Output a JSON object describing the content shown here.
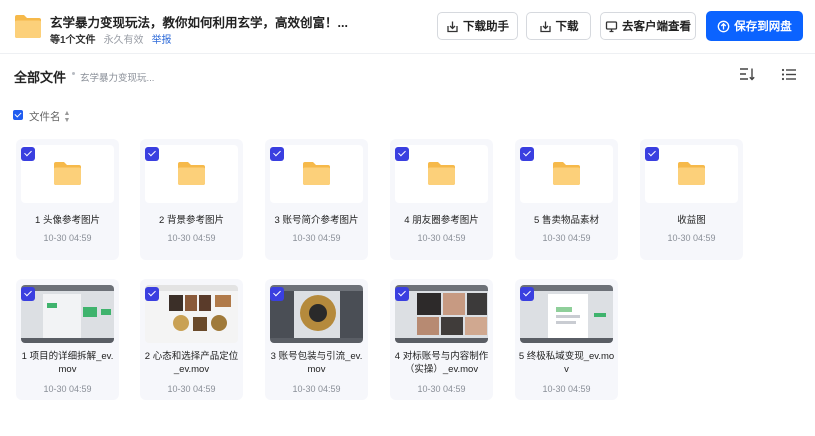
{
  "header": {
    "title": "玄学暴力变现玩法，教你如何利用玄学，高效创富！...",
    "file_count": "等1个文件",
    "validity": "永久有效",
    "report": "举报"
  },
  "actions": {
    "helper": "下载助手",
    "download": "下载",
    "client": "去客户端查看",
    "save": "保存到网盘"
  },
  "breadcrumb": {
    "root": "全部文件",
    "current": "玄学暴力变现玩..."
  },
  "list_header": {
    "column_name": "文件名"
  },
  "colors": {
    "accent": "#0b63ff",
    "checkbox": "#3a3fe0",
    "folder": "#fbc86b"
  },
  "folders": [
    {
      "name": "1 头像参考图片",
      "date": "10-30 04:59",
      "icon": "folder-icon"
    },
    {
      "name": "2 背景参考图片",
      "date": "10-30 04:59",
      "icon": "folder-icon"
    },
    {
      "name": "3 账号简介参考图片",
      "date": "10-30 04:59",
      "icon": "folder-icon"
    },
    {
      "name": "4 朋友圈参考图片",
      "date": "10-30 04:59",
      "icon": "folder-icon"
    },
    {
      "name": "5 售卖物品素材",
      "date": "10-30 04:59",
      "icon": "folder-icon"
    },
    {
      "name": "收益图",
      "date": "10-30 04:59",
      "icon": "folder-icon"
    }
  ],
  "videos": [
    {
      "name": "1 项目的详细拆解_ev.mov",
      "date": "10-30 04:59"
    },
    {
      "name": "2 心态和选择产品定位_ev.mov",
      "date": "10-30 04:59"
    },
    {
      "name": "3 账号包装与引流_ev.mov",
      "date": "10-30 04:59"
    },
    {
      "name": "4 对标账号与内容制作（实操）_ev.mov",
      "date": "10-30 04:59"
    },
    {
      "name": "5 终极私域变现_ev.mov",
      "date": "10-30 04:59"
    }
  ]
}
